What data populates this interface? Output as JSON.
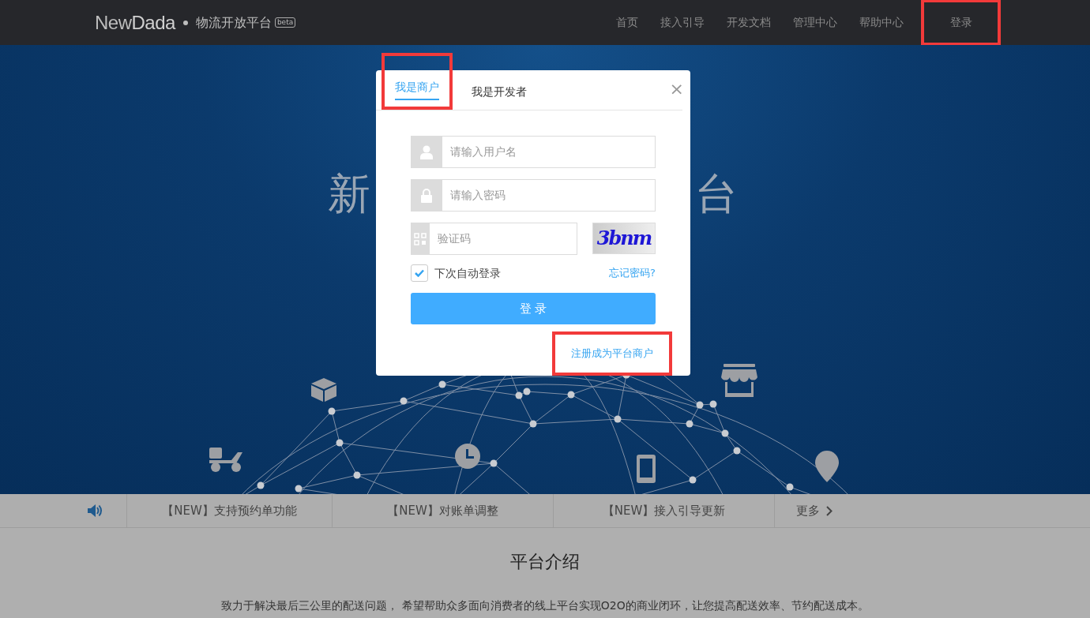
{
  "navbar": {
    "logo_light": "New",
    "logo_bold": "Dada",
    "subtitle": "物流开放平台",
    "badge": "beta",
    "items": [
      {
        "label": "首页",
        "highlighted": false
      },
      {
        "label": "接入引导",
        "highlighted": false
      },
      {
        "label": "开发文档",
        "highlighted": false
      },
      {
        "label": "管理中心",
        "highlighted": false
      },
      {
        "label": "帮助中心",
        "highlighted": false
      },
      {
        "label": "登录",
        "highlighted": true
      }
    ]
  },
  "hero": {
    "title_left": "新",
    "title_right": "台"
  },
  "login_dialog": {
    "tabs": [
      {
        "label": "我是商户",
        "selected": true,
        "highlighted": true
      },
      {
        "label": "我是开发者",
        "selected": false,
        "highlighted": false
      }
    ],
    "close": "×",
    "username": {
      "placeholder": "请输入用户名"
    },
    "password": {
      "placeholder": "请输入密码"
    },
    "captcha": {
      "placeholder": "验证码",
      "image_text": "3bnm"
    },
    "remember": {
      "label": "下次自动登录",
      "checked": true
    },
    "forgot": "忘记密码?",
    "submit": "登 录",
    "register": {
      "label": "注册成为平台商户",
      "highlighted": true
    }
  },
  "news": {
    "items": [
      "【NEW】支持预约单功能",
      "【NEW】对账单调整",
      "【NEW】接入引导更新"
    ],
    "more": "更多"
  },
  "intro": {
    "title": "平台介绍",
    "text": "致力于解决最后三公里的配送问题， 希望帮助众多面向消费者的线上平台实现O2O的商业闭环，让您提高配送效率、节约配送成本。"
  }
}
